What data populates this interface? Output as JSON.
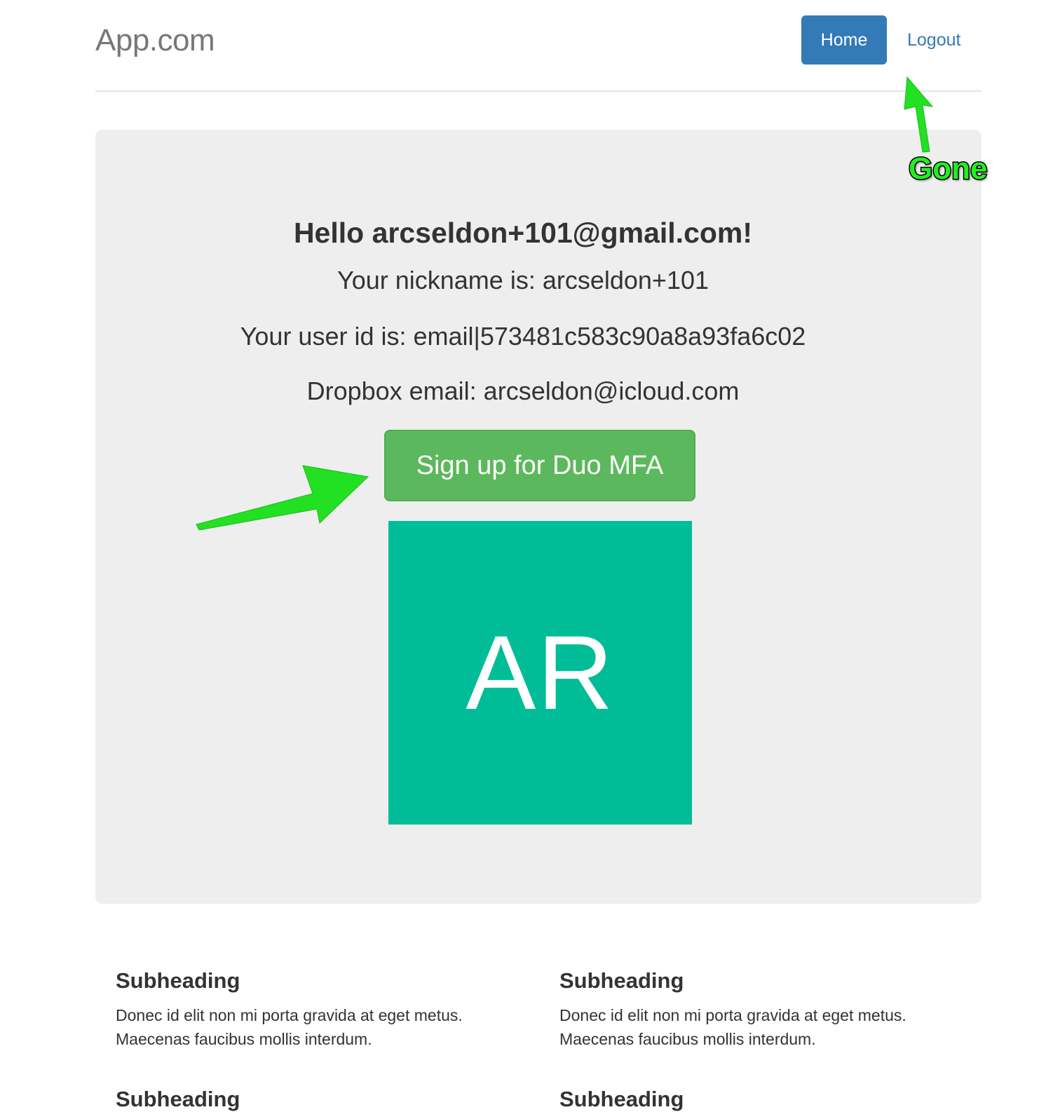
{
  "header": {
    "brand": "App.com",
    "nav": {
      "home_label": "Home",
      "logout_label": "Logout"
    }
  },
  "jumbotron": {
    "greeting": "Hello arcseldon+101@gmail.com!",
    "nickname_line": "Your nickname is: arcseldon+101",
    "user_id_line": "Your user id is: email|573481c583c90a8a93fa6c02",
    "dropbox_line": "Dropbox email: arcseldon@icloud.com",
    "duo_button_label": "Sign up for Duo MFA",
    "avatar_initials": "AR"
  },
  "annotations": {
    "gone_label": "Gone",
    "arrow_color": "#22e022"
  },
  "sections": [
    {
      "heading": "Subheading",
      "body": "Donec id elit non mi porta gravida at eget metus. Maecenas faucibus mollis interdum."
    },
    {
      "heading": "Subheading",
      "body": "Donec id elit non mi porta gravida at eget metus. Maecenas faucibus mollis interdum."
    },
    {
      "heading": "Subheading"
    },
    {
      "heading": "Subheading"
    }
  ],
  "colors": {
    "primary": "#337ab7",
    "success": "#5cb85c",
    "avatar_bg": "#00bd98",
    "jumbotron_bg": "#eeeeee"
  }
}
